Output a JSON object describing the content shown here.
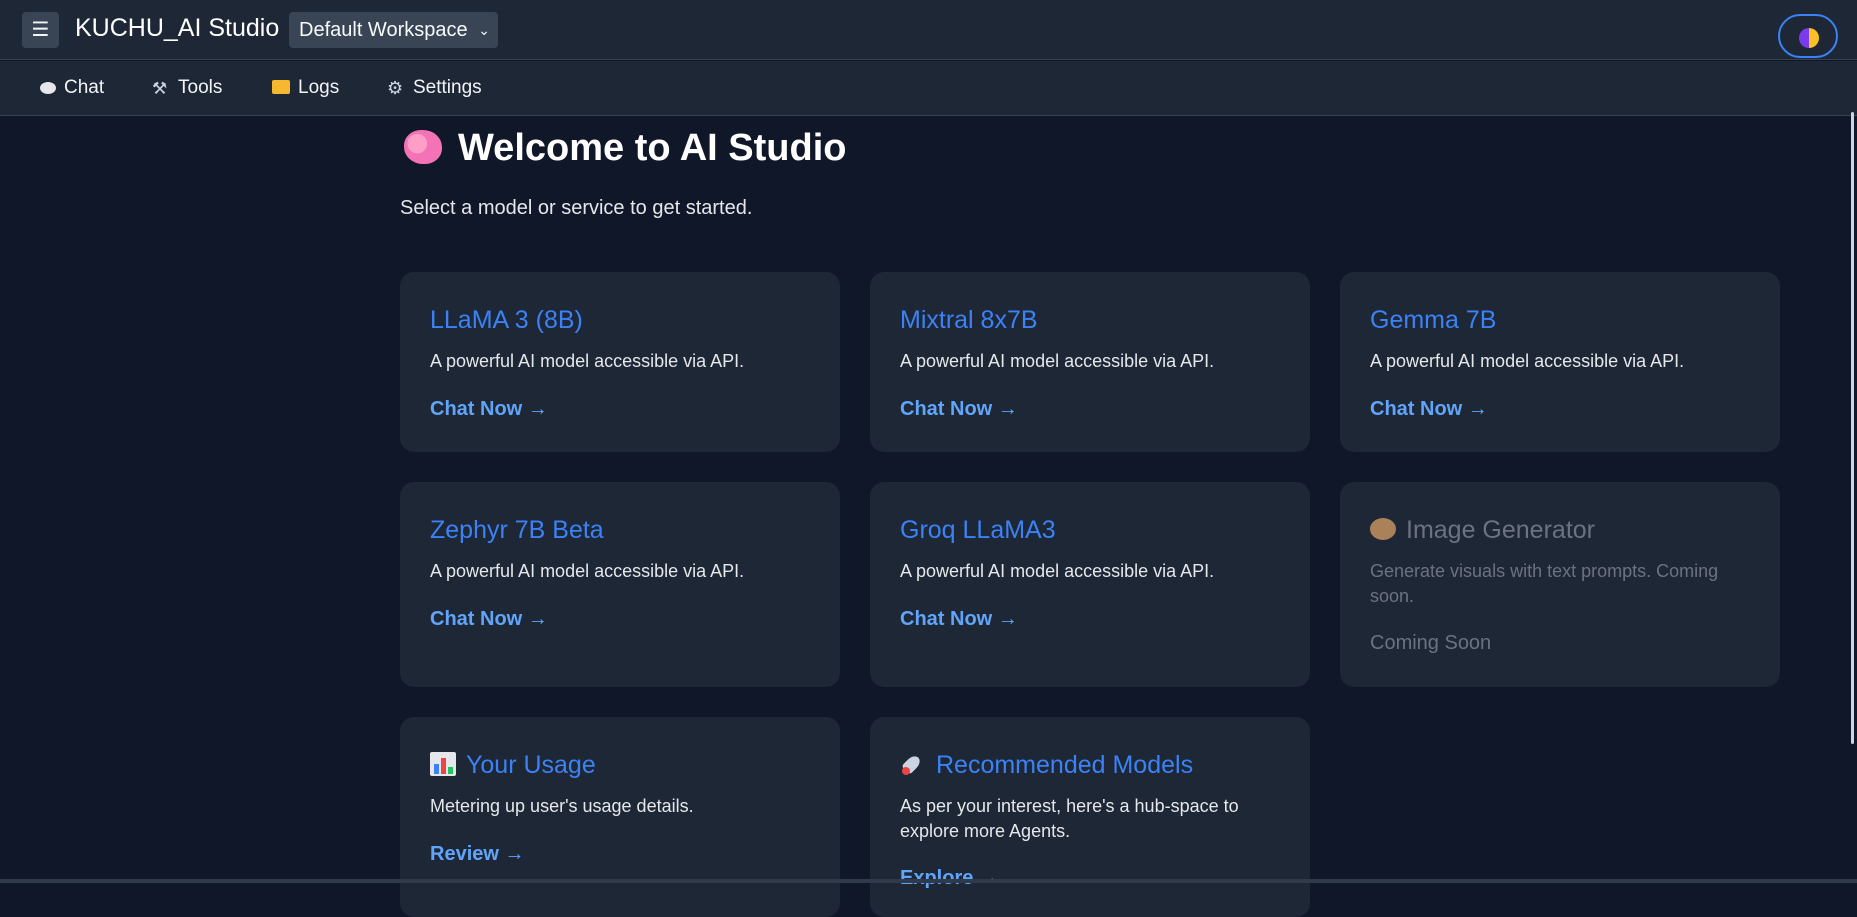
{
  "header": {
    "menu_icon": "☰",
    "app_title": "KUCHU_AI Studio",
    "workspace": "Default Workspace",
    "theme_toggle_icon": "half-moon-icon"
  },
  "tabs": [
    {
      "label": "Chat",
      "icon": "chat-bubble-icon"
    },
    {
      "label": "Tools",
      "icon": "tools-icon"
    },
    {
      "label": "Logs",
      "icon": "folder-icon"
    },
    {
      "label": "Settings",
      "icon": "gear-icon"
    }
  ],
  "main": {
    "heading": "Welcome to AI Studio",
    "subtitle": "Select a model or service to get started."
  },
  "cards": [
    {
      "title": "LLaMA 3 (8B)",
      "desc": "A powerful AI model accessible via API.",
      "link": "Chat Now →"
    },
    {
      "title": "Mixtral 8x7B",
      "desc": "A powerful AI model accessible via API.",
      "link": "Chat Now →"
    },
    {
      "title": "Gemma 7B",
      "desc": "A powerful AI model accessible via API.",
      "link": "Chat Now →"
    },
    {
      "title": "Zephyr 7B Beta",
      "desc": "A powerful AI model accessible via API.",
      "link": "Chat Now →"
    },
    {
      "title": "Groq LLaMA3",
      "desc": "A powerful AI model accessible via API.",
      "link": "Chat Now →"
    },
    {
      "title": "Image Generator",
      "desc": "Generate visuals with text prompts. Coming soon.",
      "link": "Coming Soon",
      "icon": "palette-icon",
      "disabled": true
    },
    {
      "title": "Your Usage",
      "desc": "Metering up user's usage details.",
      "link": "Review →",
      "icon": "bar-chart-icon"
    },
    {
      "title": "Recommended Models",
      "desc": "As per your interest, here's a hub-space to explore more Agents.",
      "link": "Explore →",
      "icon": "rocket-icon"
    }
  ],
  "colors": {
    "background": "#0f1729",
    "panel": "#1e2736",
    "accent": "#3b82f6",
    "link": "#60a5fa",
    "muted": "#6b7280"
  }
}
